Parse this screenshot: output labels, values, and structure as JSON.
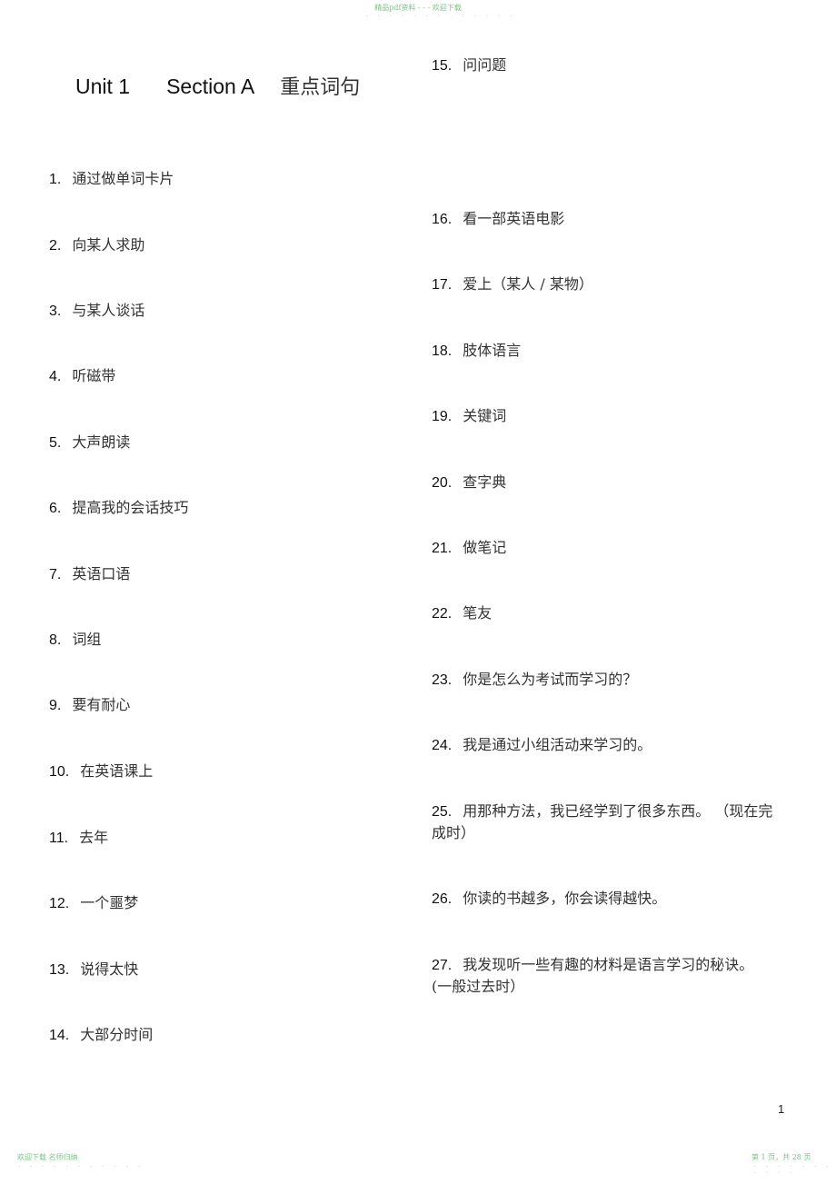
{
  "header": {
    "watermark": "精品pdf资料 - - - 欢迎下载"
  },
  "title": {
    "unit": "Unit 1",
    "section": "Section A",
    "subtitle": "重点词句"
  },
  "left_items": [
    {
      "num": "1.",
      "text": "通过做单词卡片"
    },
    {
      "num": "2.",
      "text": "向某人求助"
    },
    {
      "num": "3.",
      "text": "与某人谈话"
    },
    {
      "num": "4.",
      "text": "听磁带"
    },
    {
      "num": "5.",
      "text": "大声朗读"
    },
    {
      "num": "6.",
      "text": "提高我的会话技巧"
    },
    {
      "num": "7.",
      "text": "英语口语"
    },
    {
      "num": "8.",
      "text": "词组"
    },
    {
      "num": "9.",
      "text": "要有耐心"
    },
    {
      "num": "10.",
      "text": "在英语课上"
    },
    {
      "num": "11.",
      "text": "去年"
    },
    {
      "num": "12.",
      "text": "一个噩梦"
    },
    {
      "num": "13.",
      "text": "说得太快"
    },
    {
      "num": "14.",
      "text": "大部分时间"
    }
  ],
  "right_items": [
    {
      "num": "15.",
      "text": "问问题"
    },
    {
      "num": "16.",
      "text": "看一部英语电影"
    },
    {
      "num": "17.",
      "text": "爱上（某人 / 某物）"
    },
    {
      "num": "18.",
      "text": "肢体语言"
    },
    {
      "num": "19.",
      "text": "关键词"
    },
    {
      "num": "20.",
      "text": "查字典"
    },
    {
      "num": "21.",
      "text": "做笔记"
    },
    {
      "num": "22.",
      "text": "笔友"
    },
    {
      "num": "23.",
      "text": "你是怎么为考试而学习的？"
    },
    {
      "num": "24.",
      "text": "我是通过小组活动来学习的。"
    },
    {
      "num": "25.",
      "text": "用那种方法，我已经学到了很多东西。  （现在完成时）"
    },
    {
      "num": "26.",
      "text": "你读的书越多，你会读得越快。"
    },
    {
      "num": "27.",
      "text": "我发现听一些有趣的材料是语言学习的秘诀。(一般过去时）"
    }
  ],
  "page_number": "1",
  "footer": {
    "left": "欢迎下载  名师归纳",
    "right": "第 1 页，共 28 页"
  }
}
